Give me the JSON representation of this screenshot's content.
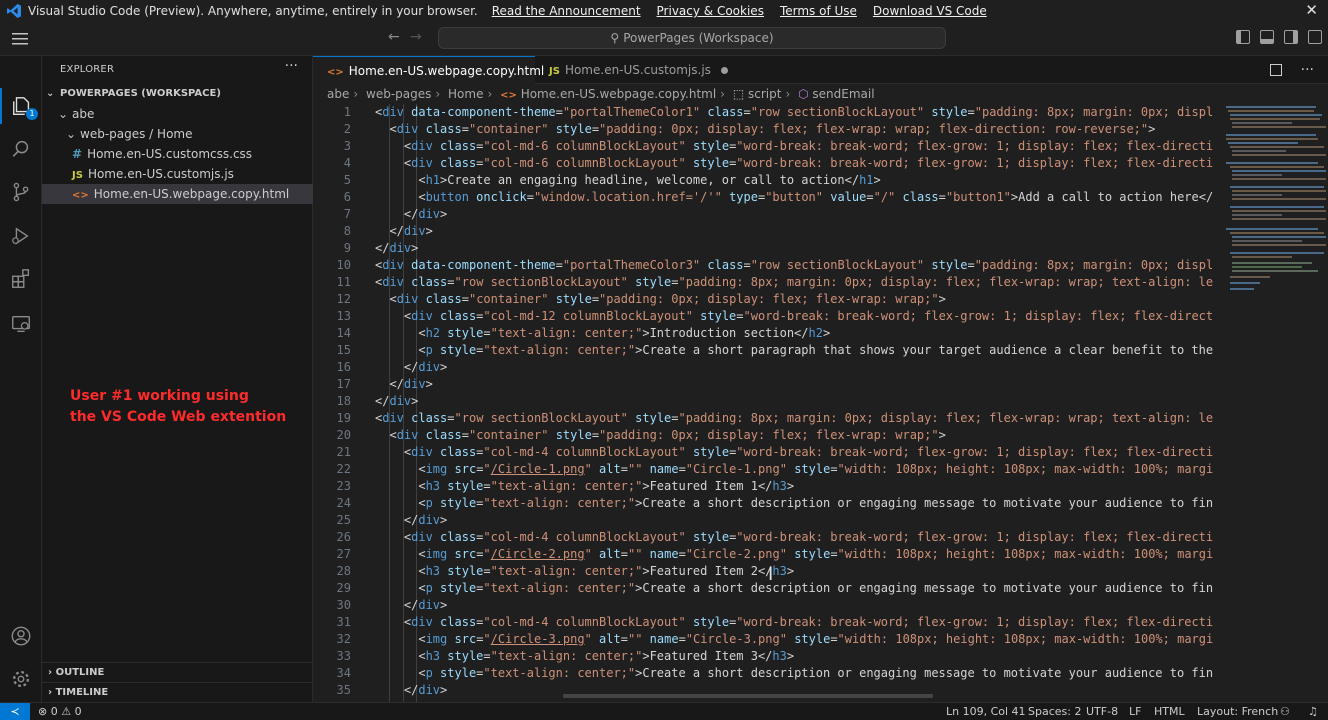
{
  "banner": {
    "text": "Visual Studio Code (Preview). Anywhere, anytime, entirely in your browser.",
    "links": [
      "Read the Announcement",
      "Privacy & Cookies",
      "Terms of Use",
      "Download VS Code"
    ],
    "close": "✕"
  },
  "titlebar": {
    "search": "PowerPages (Workspace)"
  },
  "activity": {
    "explorer_badge": "1"
  },
  "sidebar": {
    "title": "EXPLORER",
    "workspace": "POWERPAGES (WORKSPACE)",
    "tree": [
      {
        "label": "abe"
      },
      {
        "label": "web-pages / Home"
      },
      {
        "label": "Home.en-US.customcss.css",
        "icon": "#"
      },
      {
        "label": "Home.en-US.customjs.js",
        "icon": "JS"
      },
      {
        "label": "Home.en-US.webpage.copy.html",
        "icon": "<>"
      }
    ],
    "outline": "OUTLINE",
    "timeline": "TIMELINE",
    "note": [
      "User #1 working using",
      "the VS Code Web extention"
    ]
  },
  "tabs": [
    {
      "label": "Home.en-US.webpage.copy.html",
      "icon": "<>"
    },
    {
      "label": "Home.en-US.customjs.js",
      "icon": "JS"
    }
  ],
  "breadcrumb": [
    "abe",
    "web-pages",
    "Home",
    "Home.en-US.webpage.copy.html",
    "script",
    "sendEmail"
  ],
  "code_lines": [
    "1",
    "2",
    "3",
    "4",
    "5",
    "6",
    "7",
    "8",
    "9",
    "10",
    "11",
    "12",
    "13",
    "14",
    "15",
    "16",
    "17",
    "18",
    "19",
    "20",
    "21",
    "22",
    "23",
    "24",
    "25",
    "26",
    "27",
    "28",
    "29",
    "30",
    "31",
    "32",
    "33",
    "34",
    "35"
  ],
  "statusbar": {
    "errors": "0",
    "warnings": "0",
    "position": "Ln 109, Col 41",
    "spaces": "Spaces: 2",
    "encoding": "UTF-8",
    "eol": "LF",
    "language": "HTML",
    "layout": "Layout: French"
  },
  "colors": {
    "accent": "#0078d4",
    "note": "#ff2b2b"
  }
}
